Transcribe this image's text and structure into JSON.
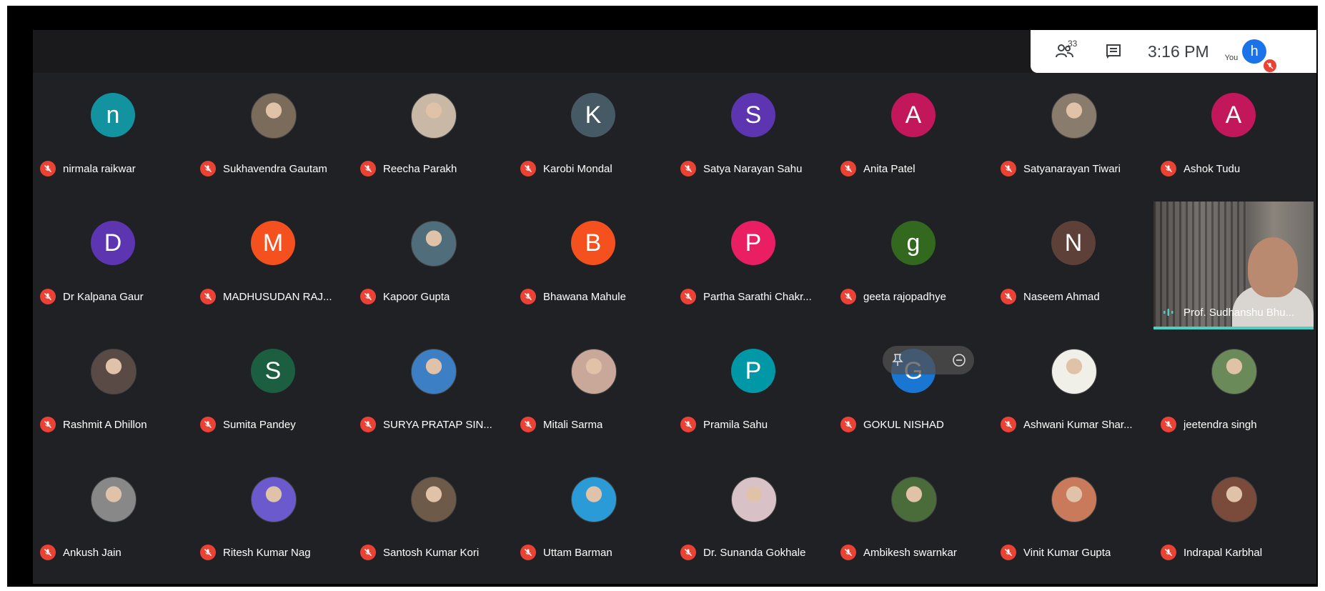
{
  "header": {
    "people_count": "33",
    "time": "3:16 PM",
    "you_label": "You",
    "you_initial": "h"
  },
  "colors": {
    "mute_red": "#ea4335",
    "speaking_teal": "#4dd0c4"
  },
  "participants": [
    {
      "name": "nirmala raikwar",
      "initial": "n",
      "color": "#12939f"
    },
    {
      "name": "Sukhavendra Gautam",
      "initial": "",
      "color": "#7a6b5a"
    },
    {
      "name": "Reecha Parakh",
      "initial": "",
      "color": "#c9b8a6"
    },
    {
      "name": "Karobi Mondal",
      "initial": "K",
      "color": "#455a64"
    },
    {
      "name": "Satya Narayan Sahu",
      "initial": "S",
      "color": "#5e35b1"
    },
    {
      "name": "Anita Patel",
      "initial": "A",
      "color": "#c2185b"
    },
    {
      "name": "Satyanarayan Tiwari",
      "initial": "",
      "color": "#8a7c6c"
    },
    {
      "name": "Ashok Tudu",
      "initial": "A",
      "color": "#c2185b"
    },
    {
      "name": "Dr Kalpana Gaur",
      "initial": "D",
      "color": "#5e35b1"
    },
    {
      "name": "MADHUSUDAN RAJ...",
      "initial": "M",
      "color": "#f4511e"
    },
    {
      "name": "Kapoor Gupta",
      "initial": "",
      "color": "#4f6d7a"
    },
    {
      "name": "Bhawana Mahule",
      "initial": "B",
      "color": "#f4511e"
    },
    {
      "name": "Partha Sarathi Chakr...",
      "initial": "P",
      "color": "#e91e63"
    },
    {
      "name": "geeta rajopadhye",
      "initial": "g",
      "color": "#33691e"
    },
    {
      "name": "Naseem Ahmad",
      "initial": "N",
      "color": "#5d4037"
    },
    {
      "name": "Rashmit A Dhillon",
      "initial": "",
      "color": "#5a4a45"
    },
    {
      "name": "Sumita Pandey",
      "initial": "S",
      "color": "#1b5e40"
    },
    {
      "name": "SURYA PRATAP SIN...",
      "initial": "",
      "color": "#3d7fc4"
    },
    {
      "name": "Mitali Sarma",
      "initial": "",
      "color": "#c9a89a"
    },
    {
      "name": "Pramila Sahu",
      "initial": "P",
      "color": "#0097a7"
    },
    {
      "name": "GOKUL NISHAD",
      "initial": "G",
      "color": "#1976d2"
    },
    {
      "name": "Ashwani Kumar Shar...",
      "initial": "",
      "color": "#f0efe8"
    },
    {
      "name": "jeetendra singh",
      "initial": "",
      "color": "#6b8a5a"
    },
    {
      "name": "Ankush Jain",
      "initial": "",
      "color": "#888888"
    },
    {
      "name": "Ritesh Kumar Nag",
      "initial": "",
      "color": "#6a5acd"
    },
    {
      "name": "Santosh Kumar Kori",
      "initial": "",
      "color": "#6e5a48"
    },
    {
      "name": "Uttam Barman",
      "initial": "",
      "color": "#2a9bd6"
    },
    {
      "name": "Dr. Sunanda Gokhale",
      "initial": "",
      "color": "#d8c2c8"
    },
    {
      "name": "Ambikesh swarnkar",
      "initial": "",
      "color": "#4a6b3a"
    },
    {
      "name": "Vinit Kumar Gupta",
      "initial": "",
      "color": "#c87a5a"
    },
    {
      "name": "Indrapal Karbhal",
      "initial": "",
      "color": "#7a4a3a"
    }
  ],
  "presenter": {
    "name": "Prof. Sudhanshu Bhu..."
  }
}
